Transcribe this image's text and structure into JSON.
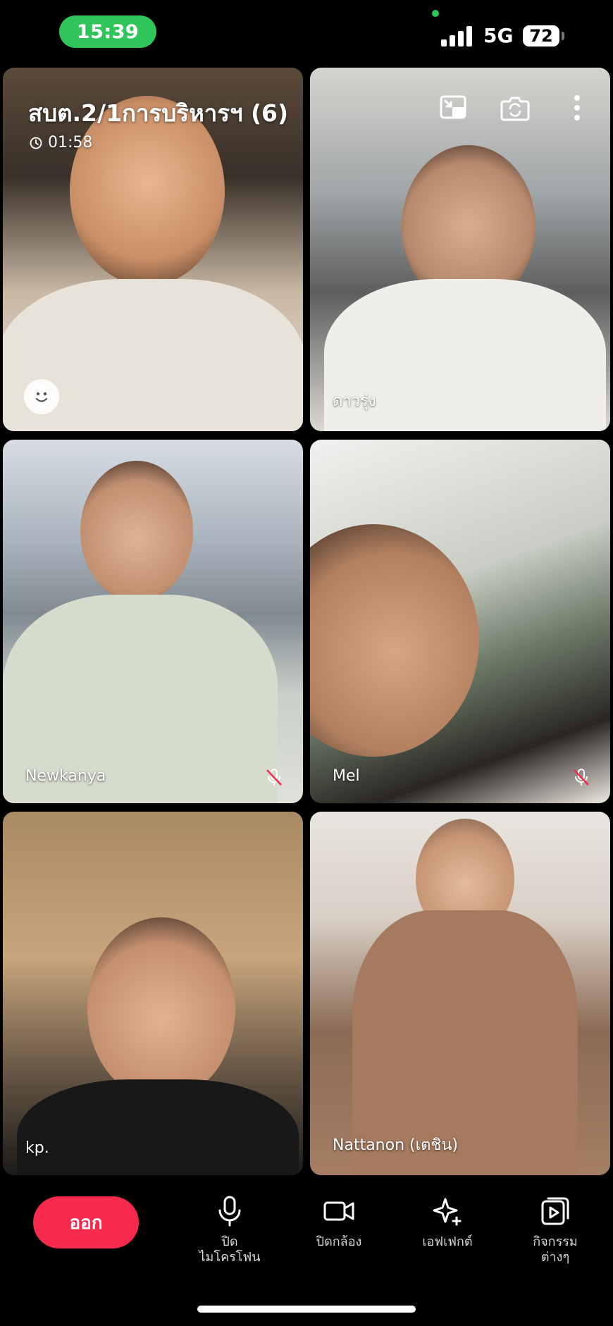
{
  "status_bar": {
    "time": "15:39",
    "network": "5G",
    "battery": "72",
    "time_pill_color": "#2fc55a"
  },
  "call": {
    "title": "สบต.2/1การบริหารฯ (6)",
    "timer": "01:58"
  },
  "participants": [
    {
      "name": ""
    },
    {
      "name": "ดาวรุ่ง"
    },
    {
      "name": "Newkanya",
      "muted": true
    },
    {
      "name": "Mel",
      "muted": true
    },
    {
      "name": "kp."
    },
    {
      "name": "Nattanon (เตชิน)"
    }
  ],
  "controls": {
    "leave_label": "ออก",
    "leave_color": "#f7294d",
    "mic_label_line1": "ปิด",
    "mic_label_line2": "ไมโครโฟน",
    "camera_label": "ปิดกล้อง",
    "effects_label": "เอฟเฟกต์",
    "activities_label_line1": "กิจกรรม",
    "activities_label_line2": "ต่างๆ"
  },
  "icons": {
    "top_actions": [
      "minimize-window-icon",
      "flip-camera-icon",
      "more-vertical-icon"
    ],
    "controls": [
      "microphone-icon",
      "video-camera-icon",
      "sparkles-icon",
      "activities-play-icon"
    ]
  }
}
